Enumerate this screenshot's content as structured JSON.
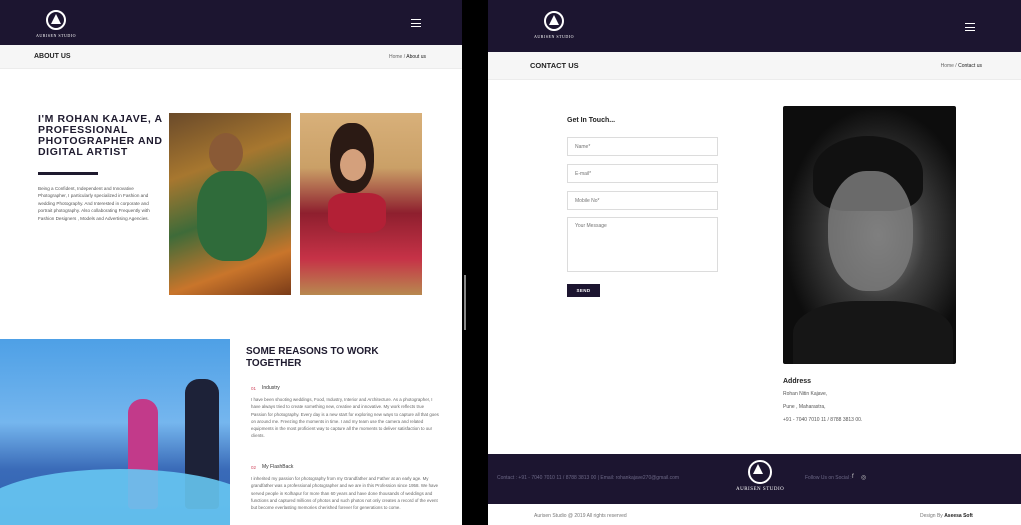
{
  "about": {
    "brand": "AURISEN STUDIO",
    "page_title": "ABOUT US",
    "breadcrumb_home": "Home",
    "breadcrumb_sep": " / ",
    "breadcrumb_current": "About us",
    "intro_heading": "I'M ROHAN KAJAVE, A PROFESSIONAL PHOTOGRAPHER AND DIGITAL ARTIST",
    "intro_text": "Being a Confident, Independent and Innovative Photographer, I particularly specialized in Fashion and wedding Photography. And Interested in corporate and portrait photography. Also collaborating Frequently with Fashion Designers , Models and Advertising Agencies.",
    "reasons_heading": "SOME REASONS TO WORK TOGETHER",
    "items": [
      {
        "num": "01",
        "title": "Industry",
        "text": "I have been shooting weddings, Food, Industry, Interior and Architecture. As a photographer, I have always tried to create something new, creative and innovative. My work reflects true Passion for photography. Every day is a new start for exploring new ways to capture all that goes on around me. Freezing the moments in time. I and my team use the camera and related equipments in the most proficient way to capture all the moments to deliver satisfaction to our clients."
      },
      {
        "num": "02",
        "title": "My FlashBack",
        "text": "I inherited my passion for photography from my Grandfather and Father at an early age. My grandfather was a professional photographer and we are in this Profession since 1958. We have served people in Kolhapur for more than 60 years and have done thousands of weddings and functions and captured millions of photos and such photos not only creates a record of the event but become everlasting memories cherished forever for generations to come."
      }
    ]
  },
  "contact": {
    "brand": "AURISEN STUDIO",
    "page_title": "CONTACT US",
    "breadcrumb_home": "Home",
    "breadcrumb_sep": " / ",
    "breadcrumb_current": "Contact us",
    "form_title": "Get In Touch...",
    "name_placeholder": "Name*",
    "email_placeholder": "E-mail*",
    "mobile_placeholder": "Mobile No*",
    "message_placeholder": "Your Message",
    "send_label": "SEND",
    "address_heading": "Address",
    "address_lines": [
      "Rohan Nitin Kajave,",
      "Pune , Maharastra,",
      "+91 - 7040 7010 11 / 8788 3813 00."
    ],
    "footer_contact": "Contact : +91 - 7040 7010 11 / 8788 3813 00 | Email: rohankajave270@gmail.com",
    "footer_follow": "Follow Us on Social :",
    "social_facebook": "f",
    "social_instagram": "◎",
    "copyright": "Aurisen Studio @ 2019 All rights reserved",
    "design_by_label": "Design By",
    "design_by_name": "Aseesa Soft"
  },
  "icons": {
    "menu": "menu-icon",
    "logo": "aurisen-logo-icon"
  }
}
